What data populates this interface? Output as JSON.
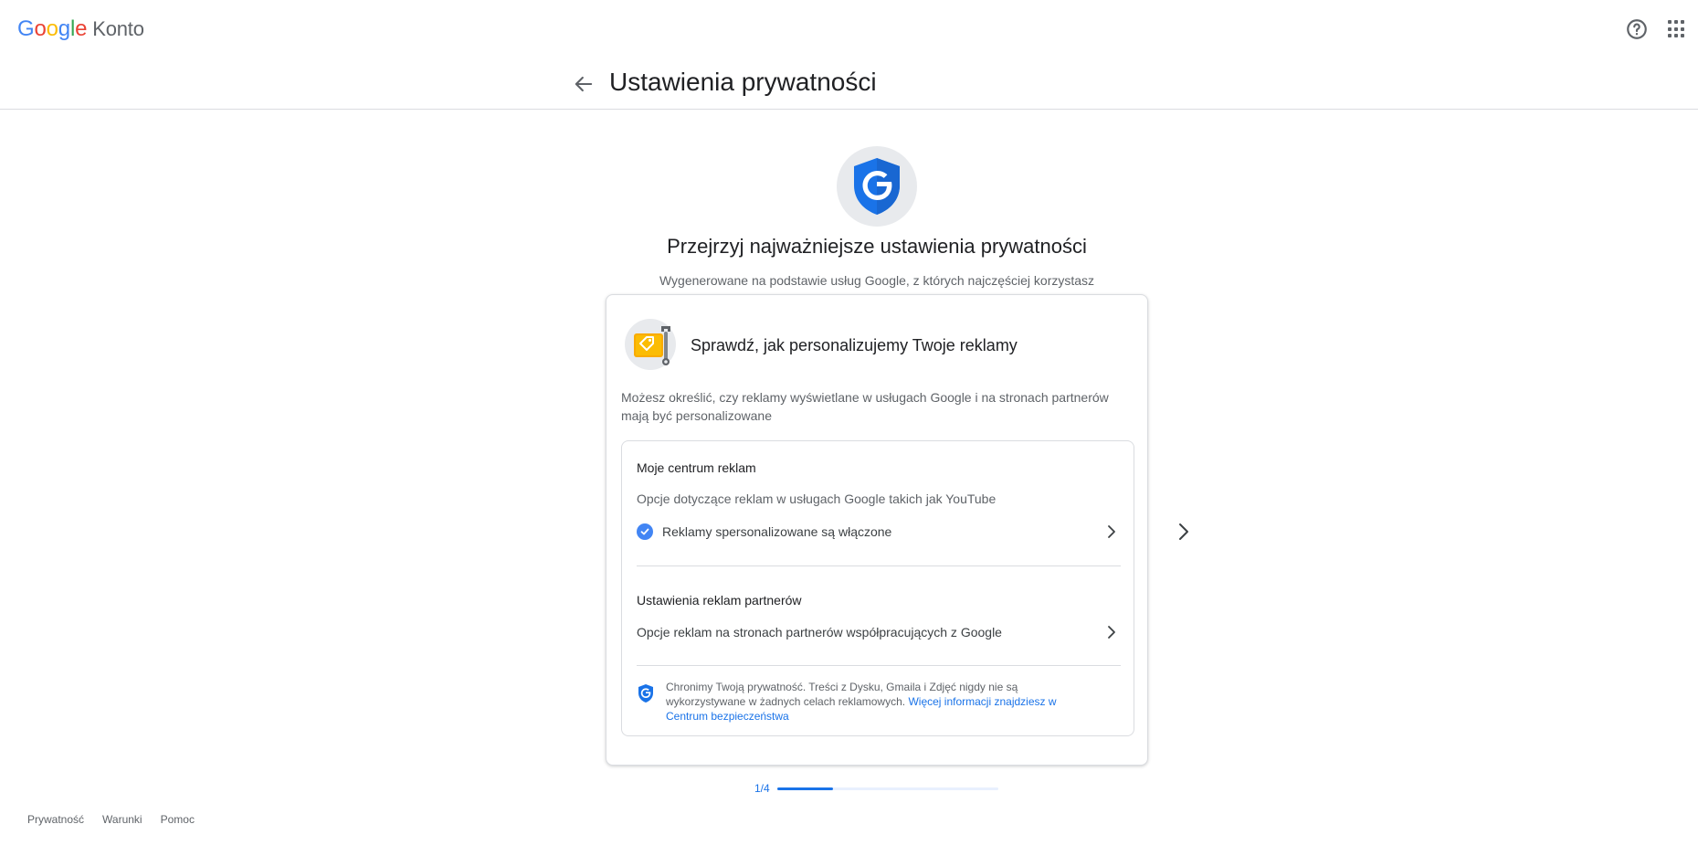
{
  "header": {
    "logo_letters": [
      "G",
      "o",
      "o",
      "g",
      "l",
      "e"
    ],
    "logo_suffix": "Konto",
    "help_icon": "help-circle-icon",
    "apps_icon": "apps-grid-icon"
  },
  "page": {
    "title": "Ustawienia prywatności",
    "back_icon": "arrow-back-icon"
  },
  "hero": {
    "icon": "google-shield-icon",
    "title": "Przejrzyj najważniejsze ustawienia prywatności",
    "subtitle": "Wygenerowane na podstawie usług Google, z których najczęściej korzystasz"
  },
  "card": {
    "icon": "ad-tag-wrench-icon",
    "title": "Sprawdź, jak personalizujemy Twoje reklamy",
    "description": "Możesz określić, czy reklamy wyświetlane w usługach Google i na stronach partnerów mają być personalizowane",
    "sections": [
      {
        "title": "Moje centrum reklam",
        "description": "Opcje dotyczące reklam w usługach Google takich jak YouTube",
        "row_text": "Reklamy spersonalizowane są włączone",
        "row_icon": "check-circle-icon"
      },
      {
        "title": "Ustawienia reklam partnerów",
        "row_text": "Opcje reklam na stronach partnerów współpracujących z Google"
      }
    ],
    "note": {
      "icon": "google-shield-small-icon",
      "text": "Chronimy Twoją prywatność. Treści z Dysku, Gmaila i Zdjęć nigdy nie są wykorzystywane w żadnych celach reklamowych.",
      "link": "Więcej informacji znajdziesz w Centrum bezpieczeństwa"
    }
  },
  "pager": {
    "label": "1/4",
    "progress": 0.25,
    "next_icon": "chevron-right-icon"
  },
  "footer": {
    "links": [
      "Prywatność",
      "Warunki",
      "Pomoc"
    ]
  },
  "colors": {
    "accent": "#1a73e8",
    "google_blue": "#4285f4",
    "google_red": "#ea4335",
    "google_yellow": "#fbbc05",
    "google_green": "#34a853"
  }
}
